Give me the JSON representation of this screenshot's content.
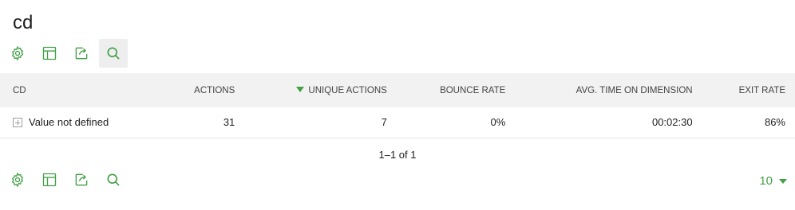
{
  "report": {
    "title": "cd"
  },
  "toolbar": {
    "icons": [
      "gear-icon",
      "table-icon",
      "export-icon",
      "search-icon"
    ]
  },
  "table": {
    "columns": {
      "label": "CD",
      "actions": "ACTIONS",
      "unique_actions": "UNIQUE ACTIONS",
      "bounce_rate": "BOUNCE RATE",
      "avg_time": "AVG. TIME ON DIMENSION",
      "exit_rate": "EXIT RATE"
    },
    "sorted_column": "unique_actions",
    "rows": [
      {
        "label": "Value not defined",
        "actions": "31",
        "unique_actions": "7",
        "bounce_rate": "0%",
        "avg_time": "00:02:30",
        "exit_rate": "86%"
      }
    ]
  },
  "pagination": {
    "text": "1–1 of 1"
  },
  "limit": {
    "value": "10"
  },
  "colors": {
    "accent": "#43a047",
    "header_bg": "#f2f2f2"
  }
}
